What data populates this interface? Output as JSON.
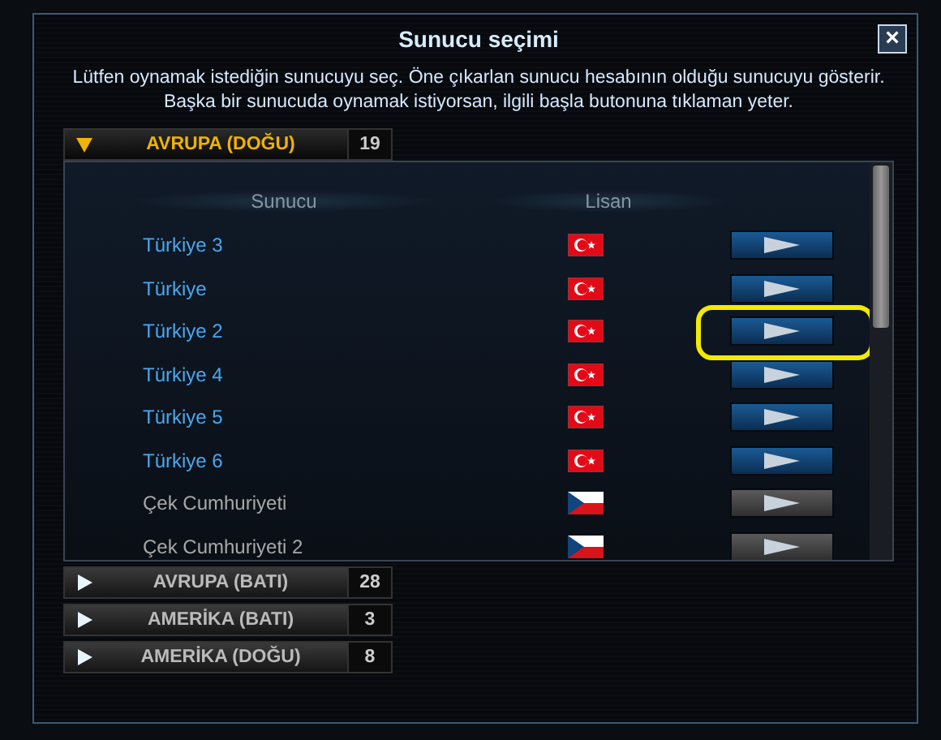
{
  "window": {
    "title": "Sunucu seçimi",
    "close": "×"
  },
  "description": "Lütfen oynamak istediğin sunucuyu seç. Öne çıkarlan sunucu hesabının olduğu sunucuyu gösterir. Başka bir sunucuda oynamak istiyorsan, ilgili başla butonuna tıklaman yeter.",
  "groups": [
    {
      "name": "AVRUPA (DOĞU)",
      "count": "19",
      "expanded": true,
      "columns": [
        "Sunucu",
        "Lisan"
      ],
      "servers": [
        {
          "name": "Türkiye 3",
          "kind": "tr",
          "available": true,
          "highlighted": false
        },
        {
          "name": "Türkiye",
          "kind": "tr",
          "available": true,
          "highlighted": false
        },
        {
          "name": "Türkiye 2",
          "kind": "tr",
          "available": true,
          "highlighted": true
        },
        {
          "name": "Türkiye 4",
          "kind": "tr",
          "available": true,
          "highlighted": false
        },
        {
          "name": "Türkiye 5",
          "kind": "tr",
          "available": true,
          "highlighted": false
        },
        {
          "name": "Türkiye 6",
          "kind": "tr",
          "available": true,
          "highlighted": false
        },
        {
          "name": "Çek Cumhuriyeti",
          "kind": "cz",
          "available": false,
          "highlighted": false
        },
        {
          "name": "Çek Cumhuriyeti 2",
          "kind": "cz",
          "available": false,
          "highlighted": false
        }
      ]
    },
    {
      "name": "AVRUPA (BATI)",
      "count": "28",
      "expanded": false
    },
    {
      "name": "AMERİKA (BATI)",
      "count": "3",
      "expanded": false
    },
    {
      "name": "AMERİKA (DOĞU)",
      "count": "8",
      "expanded": false
    }
  ]
}
